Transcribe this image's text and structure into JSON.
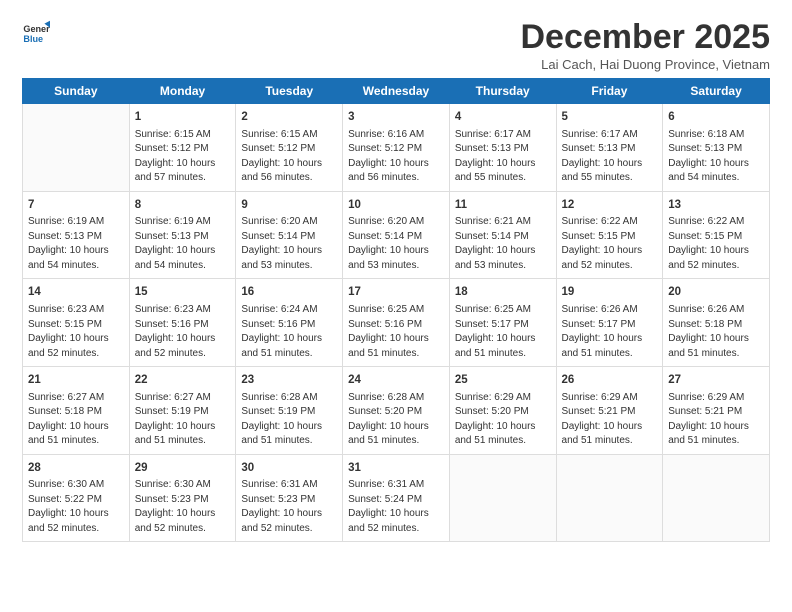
{
  "logo": {
    "line1": "General",
    "line2": "Blue"
  },
  "title": "December 2025",
  "location": "Lai Cach, Hai Duong Province, Vietnam",
  "header_days": [
    "Sunday",
    "Monday",
    "Tuesday",
    "Wednesday",
    "Thursday",
    "Friday",
    "Saturday"
  ],
  "weeks": [
    [
      {
        "day": "",
        "content": ""
      },
      {
        "day": "1",
        "content": "Sunrise: 6:15 AM\nSunset: 5:12 PM\nDaylight: 10 hours\nand 57 minutes."
      },
      {
        "day": "2",
        "content": "Sunrise: 6:15 AM\nSunset: 5:12 PM\nDaylight: 10 hours\nand 56 minutes."
      },
      {
        "day": "3",
        "content": "Sunrise: 6:16 AM\nSunset: 5:12 PM\nDaylight: 10 hours\nand 56 minutes."
      },
      {
        "day": "4",
        "content": "Sunrise: 6:17 AM\nSunset: 5:13 PM\nDaylight: 10 hours\nand 55 minutes."
      },
      {
        "day": "5",
        "content": "Sunrise: 6:17 AM\nSunset: 5:13 PM\nDaylight: 10 hours\nand 55 minutes."
      },
      {
        "day": "6",
        "content": "Sunrise: 6:18 AM\nSunset: 5:13 PM\nDaylight: 10 hours\nand 54 minutes."
      }
    ],
    [
      {
        "day": "7",
        "content": "Sunrise: 6:19 AM\nSunset: 5:13 PM\nDaylight: 10 hours\nand 54 minutes."
      },
      {
        "day": "8",
        "content": "Sunrise: 6:19 AM\nSunset: 5:13 PM\nDaylight: 10 hours\nand 54 minutes."
      },
      {
        "day": "9",
        "content": "Sunrise: 6:20 AM\nSunset: 5:14 PM\nDaylight: 10 hours\nand 53 minutes."
      },
      {
        "day": "10",
        "content": "Sunrise: 6:20 AM\nSunset: 5:14 PM\nDaylight: 10 hours\nand 53 minutes."
      },
      {
        "day": "11",
        "content": "Sunrise: 6:21 AM\nSunset: 5:14 PM\nDaylight: 10 hours\nand 53 minutes."
      },
      {
        "day": "12",
        "content": "Sunrise: 6:22 AM\nSunset: 5:15 PM\nDaylight: 10 hours\nand 52 minutes."
      },
      {
        "day": "13",
        "content": "Sunrise: 6:22 AM\nSunset: 5:15 PM\nDaylight: 10 hours\nand 52 minutes."
      }
    ],
    [
      {
        "day": "14",
        "content": "Sunrise: 6:23 AM\nSunset: 5:15 PM\nDaylight: 10 hours\nand 52 minutes."
      },
      {
        "day": "15",
        "content": "Sunrise: 6:23 AM\nSunset: 5:16 PM\nDaylight: 10 hours\nand 52 minutes."
      },
      {
        "day": "16",
        "content": "Sunrise: 6:24 AM\nSunset: 5:16 PM\nDaylight: 10 hours\nand 51 minutes."
      },
      {
        "day": "17",
        "content": "Sunrise: 6:25 AM\nSunset: 5:16 PM\nDaylight: 10 hours\nand 51 minutes."
      },
      {
        "day": "18",
        "content": "Sunrise: 6:25 AM\nSunset: 5:17 PM\nDaylight: 10 hours\nand 51 minutes."
      },
      {
        "day": "19",
        "content": "Sunrise: 6:26 AM\nSunset: 5:17 PM\nDaylight: 10 hours\nand 51 minutes."
      },
      {
        "day": "20",
        "content": "Sunrise: 6:26 AM\nSunset: 5:18 PM\nDaylight: 10 hours\nand 51 minutes."
      }
    ],
    [
      {
        "day": "21",
        "content": "Sunrise: 6:27 AM\nSunset: 5:18 PM\nDaylight: 10 hours\nand 51 minutes."
      },
      {
        "day": "22",
        "content": "Sunrise: 6:27 AM\nSunset: 5:19 PM\nDaylight: 10 hours\nand 51 minutes."
      },
      {
        "day": "23",
        "content": "Sunrise: 6:28 AM\nSunset: 5:19 PM\nDaylight: 10 hours\nand 51 minutes."
      },
      {
        "day": "24",
        "content": "Sunrise: 6:28 AM\nSunset: 5:20 PM\nDaylight: 10 hours\nand 51 minutes."
      },
      {
        "day": "25",
        "content": "Sunrise: 6:29 AM\nSunset: 5:20 PM\nDaylight: 10 hours\nand 51 minutes."
      },
      {
        "day": "26",
        "content": "Sunrise: 6:29 AM\nSunset: 5:21 PM\nDaylight: 10 hours\nand 51 minutes."
      },
      {
        "day": "27",
        "content": "Sunrise: 6:29 AM\nSunset: 5:21 PM\nDaylight: 10 hours\nand 51 minutes."
      }
    ],
    [
      {
        "day": "28",
        "content": "Sunrise: 6:30 AM\nSunset: 5:22 PM\nDaylight: 10 hours\nand 52 minutes."
      },
      {
        "day": "29",
        "content": "Sunrise: 6:30 AM\nSunset: 5:23 PM\nDaylight: 10 hours\nand 52 minutes."
      },
      {
        "day": "30",
        "content": "Sunrise: 6:31 AM\nSunset: 5:23 PM\nDaylight: 10 hours\nand 52 minutes."
      },
      {
        "day": "31",
        "content": "Sunrise: 6:31 AM\nSunset: 5:24 PM\nDaylight: 10 hours\nand 52 minutes."
      },
      {
        "day": "",
        "content": ""
      },
      {
        "day": "",
        "content": ""
      },
      {
        "day": "",
        "content": ""
      }
    ]
  ]
}
